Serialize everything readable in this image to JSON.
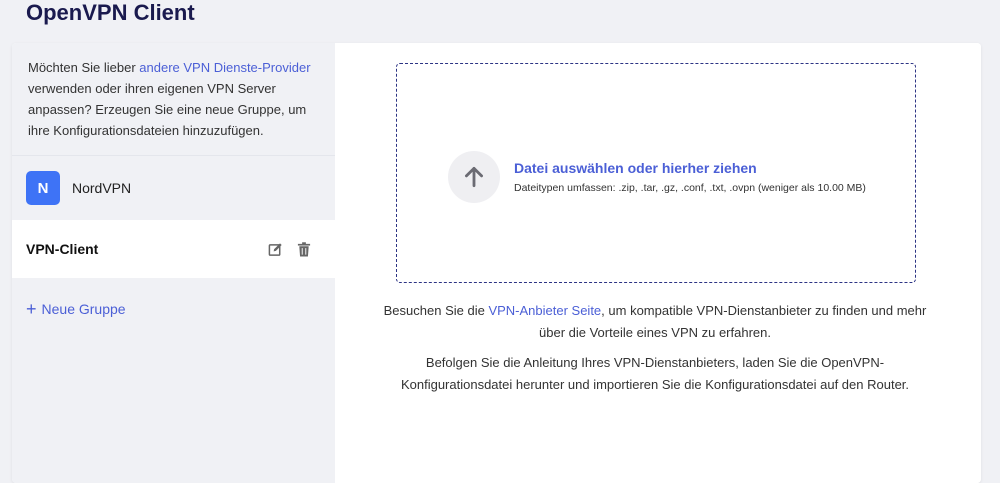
{
  "page": {
    "title": "OpenVPN Client"
  },
  "sidebar": {
    "intro_before": "Möchten Sie lieber ",
    "intro_link": "andere VPN Dienste-Provider",
    "intro_after": " verwenden oder ihren eigenen VPN Server anpassen? Erzeugen Sie eine neue Gruppe, um ihre Konfigurationsdateien hinzuzufügen.",
    "provider": {
      "logo_letter": "N",
      "name": "NordVPN",
      "logo_color": "#3e73f6"
    },
    "group": {
      "name": "VPN-Client",
      "edit_icon": "edit-icon",
      "delete_icon": "trash-icon"
    },
    "new_group": {
      "plus": "+",
      "label": "Neue Gruppe"
    }
  },
  "upload": {
    "icon": "arrow-up-icon",
    "title": "Datei auswählen oder hierher ziehen",
    "subtitle": "Dateitypen umfassen: .zip, .tar, .gz, .conf, .txt, .ovpn (weniger als 10.00 MB)"
  },
  "info": {
    "p1_before": "Besuchen Sie die ",
    "p1_link": "VPN-Anbieter Seite",
    "p1_after": ", um kompatible VPN-Dienstanbieter zu finden und mehr über die Vorteile eines VPN zu erfahren.",
    "p2": "Befolgen Sie die Anleitung Ihres VPN-Dienstanbieters, laden Sie die OpenVPN-Konfigurationsdatei herunter und importieren Sie die Konfigurationsdatei auf den Router."
  },
  "colors": {
    "accent": "#4b5fd6",
    "title": "#1a1a4e",
    "dropzone_border": "#2c3384"
  }
}
